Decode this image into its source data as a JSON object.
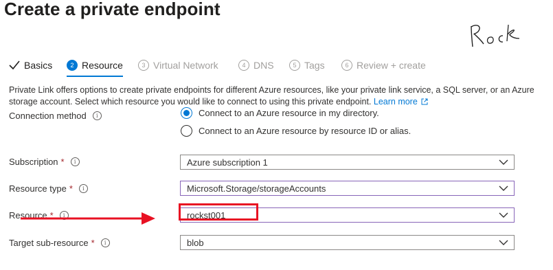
{
  "page": {
    "title": "Create a private endpoint",
    "more_label": "···",
    "signature_text": "Rock"
  },
  "tabs": [
    {
      "number": "✓",
      "label": "Basics",
      "state": "done"
    },
    {
      "number": "2",
      "label": "Resource",
      "state": "active"
    },
    {
      "number": "3",
      "label": "Virtual Network",
      "state": "disabled"
    },
    {
      "number": "4",
      "label": "DNS",
      "state": "disabled"
    },
    {
      "number": "5",
      "label": "Tags",
      "state": "disabled"
    },
    {
      "number": "6",
      "label": "Review + create",
      "state": "disabled"
    }
  ],
  "description": {
    "text": "Private Link offers options to create private endpoints for different Azure resources, like your private link service, a SQL server, or an Azure storage account. Select which resource you would like to connect to using this private endpoint.",
    "link_label": "Learn more"
  },
  "connection_method": {
    "label": "Connection method",
    "options": [
      {
        "label": "Connect to an Azure resource in my directory.",
        "selected": true
      },
      {
        "label": "Connect to an Azure resource by resource ID or alias.",
        "selected": false
      }
    ]
  },
  "fields": {
    "subscription": {
      "label": "Subscription",
      "required": "*",
      "value": "Azure subscription 1"
    },
    "resource_type": {
      "label": "Resource type",
      "required": "*",
      "value": "Microsoft.Storage/storageAccounts"
    },
    "resource": {
      "label": "Resource",
      "required": "*",
      "value": "rockst001"
    },
    "target_sub_resource": {
      "label": "Target sub-resource",
      "required": "*",
      "value": "blob"
    }
  },
  "colors": {
    "accent": "#0078d4",
    "annotation_red": "#e81123",
    "focus_purple": "#8764b8"
  }
}
